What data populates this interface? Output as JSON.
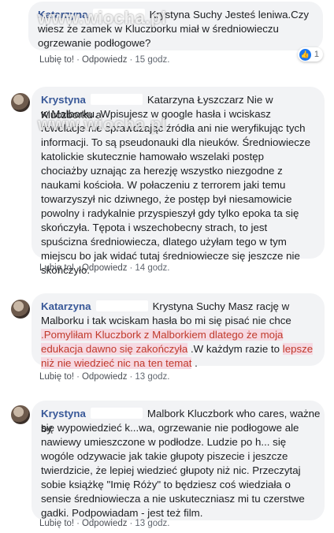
{
  "comments": [
    {
      "author": "Katarzyna",
      "mention": "Krystyna Suchy",
      "text_lines": [
        "Jesteś leniwa.Czy",
        "wiesz że zamek w Kluczborku miał w średniowieczu",
        "ogrzewanie podłogowe?"
      ],
      "like": "Lubię to!",
      "reply": "Odpowiedz",
      "time": "15 godz.",
      "reaction_count": "1"
    },
    {
      "author": "Krystyna",
      "mention": "Katarzyna Łyszczarz",
      "text_lines": [
        "Nie w Kluczborku a",
        "w Malborku. Wpisujesz w google hasła i wciskasz",
        "rewelacje nie sprawdzając źródła ani nie weryfikując tych",
        "informacji. To są pseudonauki dla nieuków. Średniowiecze",
        "katolickie skutecznie hamowało wszelaki postęp",
        "chociażby uznając za herezję wszystko niezgodne z",
        "naukami kościoła. W połaczeniu z terrorem jaki temu",
        "towarzyszył nic dziwnego, że postęp był niesamowicie",
        "powolny i radykalnie przyspieszył gdy tylko epoka ta się",
        "skończyła. Tępota i wszechobecny strach, to jest",
        "spuścizna średniowiecza, dlatego użyłam tego w tym",
        "miejscu bo jak widać tutaj średniowiecze się jeszcze nie",
        "skończyło."
      ],
      "like": "Lubię to!",
      "reply": "Odpowiedz",
      "time": "14 godz."
    },
    {
      "author": "Katarzyna",
      "mention": "Krystyna Suchy",
      "text_line1": "Masz rację w",
      "text_line2": "Malborku i tak wciskam hasła bo mi się pisać nie chce",
      "hl_line3": ".Pomyliłam Kluczbork z Malborkiem dlatego że moja",
      "hl_line4": "edukacja dawno się zakończyła",
      "plain_line4": " .W każdym razie to ",
      "hl_line4b": "lepsze",
      "hl_line5": "niż nie wiedzieć nic na ten temat",
      "plain_line5": " .",
      "like": "Lubię to!",
      "reply": "Odpowiedz",
      "time": "13 godz."
    },
    {
      "author": "Krystyna",
      "text_lines": [
        "Malbork Kluczbork who cares, ważne by",
        "się wypowiedzieć k...wa, ogrzewanie nie podłogowe ale",
        "nawiewy umieszczone w podłodze. Ludzie po h... się",
        "wogóle odzywacie jak takie głupoty piszecie i jeszcze",
        "twierdzicie, że lepiej wiedzieć głupoty niż nic. Przeczytaj",
        "sobie książkę \"Imię Róży\" to będziesz coś wiedziała o",
        "sensie średniowiecza a nie uskuteczniasz mi tu czerstwe",
        "gadki. Podpowiadam - jest też film."
      ],
      "like": "Lubię to!",
      "reply": "Odpowiedz",
      "time": "13 godz."
    }
  ],
  "watermark": "www.wiocha.pl",
  "colors": {
    "author": "#385898",
    "bubble": "#f2f3f5",
    "highlight": "#c0392b",
    "like_badge": "#1877f2"
  }
}
